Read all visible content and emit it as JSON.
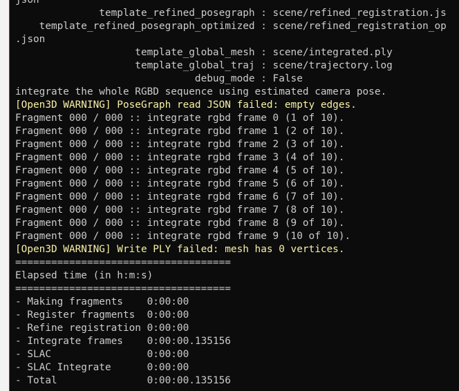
{
  "terminal": {
    "lines": [
      {
        "text": "json",
        "kind": "normal"
      },
      {
        "text": "              template_refined_posegraph : scene/refined_registration.js",
        "kind": "normal"
      },
      {
        "text": "    template_refined_posegraph_optimized : scene/refined_registration_op",
        "kind": "normal"
      },
      {
        "text": ".json",
        "kind": "normal"
      },
      {
        "text": "                    template_global_mesh : scene/integrated.ply",
        "kind": "normal"
      },
      {
        "text": "                    template_global_traj : scene/trajectory.log",
        "kind": "normal"
      },
      {
        "text": "                              debug_mode : False",
        "kind": "normal"
      },
      {
        "text": "integrate the whole RGBD sequence using estimated camera pose.",
        "kind": "normal"
      },
      {
        "text": "[Open3D WARNING] PoseGraph read JSON failed: empty edges.",
        "kind": "warning"
      },
      {
        "text": "Fragment 000 / 000 :: integrate rgbd frame 0 (1 of 10).",
        "kind": "normal"
      },
      {
        "text": "Fragment 000 / 000 :: integrate rgbd frame 1 (2 of 10).",
        "kind": "normal"
      },
      {
        "text": "Fragment 000 / 000 :: integrate rgbd frame 2 (3 of 10).",
        "kind": "normal"
      },
      {
        "text": "Fragment 000 / 000 :: integrate rgbd frame 3 (4 of 10).",
        "kind": "normal"
      },
      {
        "text": "Fragment 000 / 000 :: integrate rgbd frame 4 (5 of 10).",
        "kind": "normal"
      },
      {
        "text": "Fragment 000 / 000 :: integrate rgbd frame 5 (6 of 10).",
        "kind": "normal"
      },
      {
        "text": "Fragment 000 / 000 :: integrate rgbd frame 6 (7 of 10).",
        "kind": "normal"
      },
      {
        "text": "Fragment 000 / 000 :: integrate rgbd frame 7 (8 of 10).",
        "kind": "normal"
      },
      {
        "text": "Fragment 000 / 000 :: integrate rgbd frame 8 (9 of 10).",
        "kind": "normal"
      },
      {
        "text": "Fragment 000 / 000 :: integrate rgbd frame 9 (10 of 10).",
        "kind": "normal"
      },
      {
        "text": "[Open3D WARNING] Write PLY failed: mesh has 0 vertices.",
        "kind": "warning"
      },
      {
        "text": "====================================",
        "kind": "normal"
      },
      {
        "text": "Elapsed time (in h:m:s)",
        "kind": "normal"
      },
      {
        "text": "====================================",
        "kind": "normal"
      },
      {
        "text": "- Making fragments    0:00:00",
        "kind": "normal"
      },
      {
        "text": "- Register fragments  0:00:00",
        "kind": "normal"
      },
      {
        "text": "- Refine registration 0:00:00",
        "kind": "normal"
      },
      {
        "text": "- Integrate frames    0:00:00.135156",
        "kind": "normal"
      },
      {
        "text": "- SLAC                0:00:00",
        "kind": "normal"
      },
      {
        "text": "- SLAC Integrate      0:00:00",
        "kind": "normal"
      },
      {
        "text": "- Total               0:00:00.135156",
        "kind": "normal"
      }
    ]
  },
  "colors": {
    "background": "#0c0c0c",
    "text": "#cccccc",
    "warning": "#f9f1a5",
    "left_border": "#f3f3f3",
    "accent_line": "#c42b1c"
  }
}
